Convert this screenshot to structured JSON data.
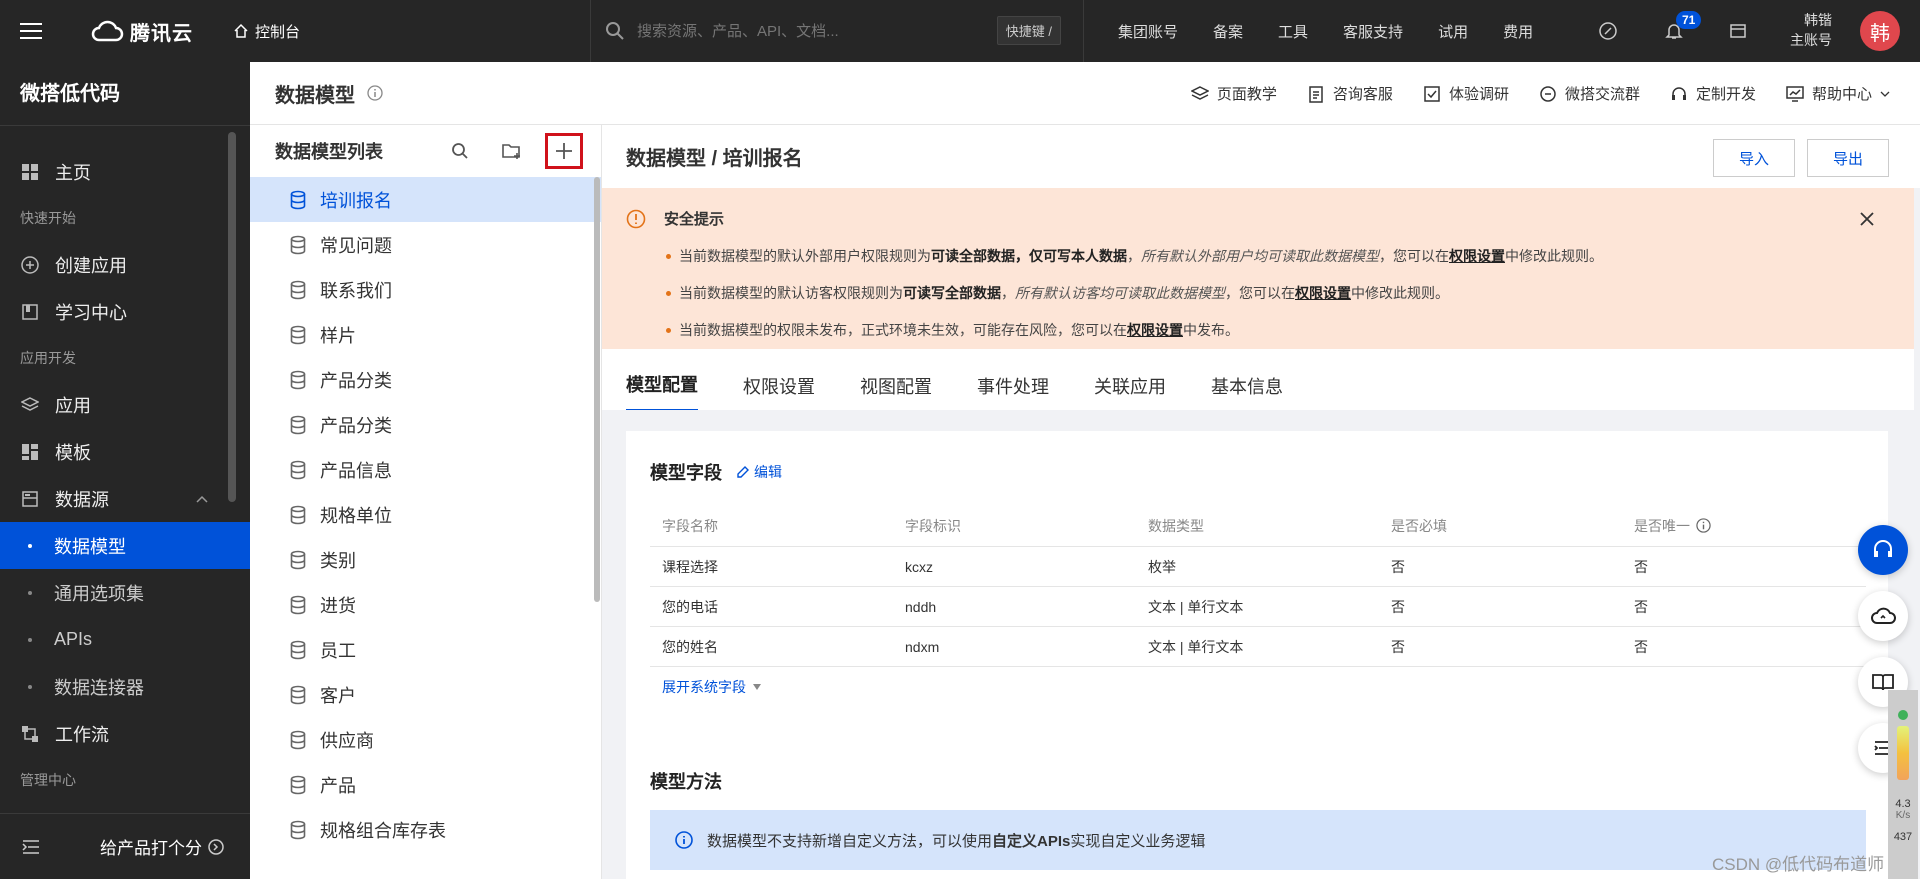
{
  "topbar": {
    "brand": "腾讯云",
    "console": "控制台",
    "search_placeholder": "搜索资源、产品、API、文档...",
    "shortcut": "快捷键 /",
    "nav": [
      "集团账号",
      "备案",
      "工具",
      "客服支持",
      "试用",
      "费用"
    ],
    "notification_count": "71",
    "user_name": "韩锴",
    "user_role": "主账号",
    "avatar_char": "韩"
  },
  "sidebar": {
    "title": "微搭低代码",
    "home": "主页",
    "group_quickstart": "快速开始",
    "create_app": "创建应用",
    "learning": "学习中心",
    "group_appdev": "应用开发",
    "apps": "应用",
    "templates": "模板",
    "datasource": "数据源",
    "sub": [
      "数据模型",
      "通用选项集",
      "APIs",
      "数据连接器"
    ],
    "workflow": "工作流",
    "group_admin": "管理中心",
    "rate": "给产品打个分"
  },
  "header": {
    "title": "数据模型",
    "links": [
      "页面教学",
      "咨询客服",
      "体验调研",
      "微搭交流群",
      "定制开发",
      "帮助中心"
    ]
  },
  "list": {
    "title": "数据模型列表",
    "items": [
      "培训报名",
      "常见问题",
      "联系我们",
      "样片",
      "产品分类",
      "产品分类",
      "产品信息",
      "规格单位",
      "类别",
      "进货",
      "员工",
      "客户",
      "供应商",
      "产品",
      "规格组合库存表"
    ]
  },
  "content": {
    "breadcrumb": "数据模型 / 培训报名",
    "import": "导入",
    "export": "导出",
    "alert": {
      "title": "安全提示",
      "l1a": "当前数据模型的默认外部用户权限规则为",
      "l1b": "可读全部数据，仅可写本人数据",
      "l1c": "，",
      "l1d": "所有默认外部用户均可读取此数据模型",
      "l1e": "，您可以在",
      "l1f": "权限设置",
      "l1g": "中修改此规则。",
      "l2a": "当前数据模型的默认访客权限规则为",
      "l2b": "可读写全部数据",
      "l2c": "，",
      "l2d": "所有默认访客均可读取此数据模型",
      "l2e": "，您可以在",
      "l2f": "权限设置",
      "l2g": "中修改此规则。",
      "l3a": "当前数据模型的权限未发布，正式环境未生效，可能存在风险，您可以在",
      "l3b": "权限设置",
      "l3c": "中发布。"
    },
    "tabs": [
      "模型配置",
      "权限设置",
      "视图配置",
      "事件处理",
      "关联应用",
      "基本信息"
    ],
    "fields": {
      "title": "模型字段",
      "edit": "编辑",
      "headers": [
        "字段名称",
        "字段标识",
        "数据类型",
        "是否必填",
        "是否唯一"
      ],
      "rows": [
        [
          "课程选择",
          "kcxz",
          "枚举",
          "否",
          "否"
        ],
        [
          "您的电话",
          "nddh",
          "文本 | 单行文本",
          "否",
          "否"
        ],
        [
          "您的姓名",
          "ndxm",
          "文本 | 单行文本",
          "否",
          "否"
        ]
      ],
      "expand": "展开系统字段"
    },
    "methods": {
      "title": "模型方法",
      "info_a": "数据模型不支持新增自定义方法，可以使用",
      "info_b": "自定义APIs",
      "info_c": "实现自定义业务逻辑"
    }
  },
  "meter": {
    "speed": "4.3",
    "unit": "K/s",
    "value": "437"
  },
  "watermark": "CSDN @低代码布道师",
  "colors": {
    "accent": "#0052d9",
    "alert_bg": "#fde5d7",
    "highlight": "#d0121b"
  }
}
